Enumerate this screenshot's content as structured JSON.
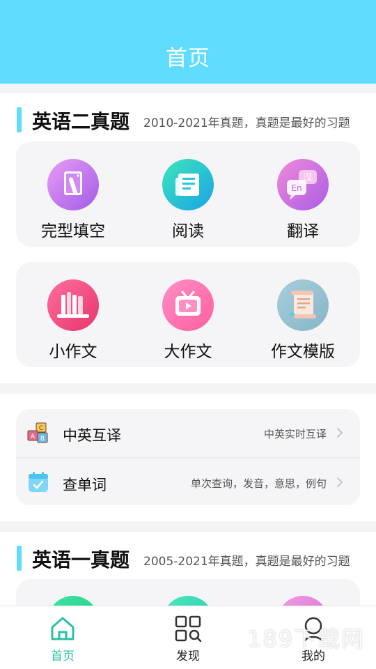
{
  "header": {
    "title": "首页"
  },
  "colors": {
    "accent": "#5fdcff",
    "tab_active": "#2bbfa4"
  },
  "section_english2": {
    "title": "英语二真题",
    "subtitle": "2010-2021年真题，真题是最好的习题",
    "items": [
      {
        "label": "完型填空",
        "icon": "book-icon"
      },
      {
        "label": "阅读",
        "icon": "newspaper-icon"
      },
      {
        "label": "翻译",
        "icon": "translate-bubble-icon"
      },
      {
        "label": "小作文",
        "icon": "bookshelf-icon"
      },
      {
        "label": "大作文",
        "icon": "tv-play-icon"
      },
      {
        "label": "作文模版",
        "icon": "scroll-icon"
      }
    ]
  },
  "tools": {
    "items": [
      {
        "label": "中英互译",
        "desc": "中英实时互译",
        "icon": "abc-blocks-icon"
      },
      {
        "label": "查单词",
        "desc": "单次查询，发音，意思，例句",
        "icon": "calendar-check-icon"
      }
    ]
  },
  "section_english1": {
    "title": "英语一真题",
    "subtitle": "2005-2021年真题，真题是最好的习题"
  },
  "tabbar": {
    "tabs": [
      {
        "label": "首页",
        "icon": "home-icon",
        "active": true
      },
      {
        "label": "发现",
        "icon": "grid-search-icon",
        "active": false
      },
      {
        "label": "我的",
        "icon": "person-icon",
        "active": false
      }
    ]
  },
  "watermark": "189下载网"
}
